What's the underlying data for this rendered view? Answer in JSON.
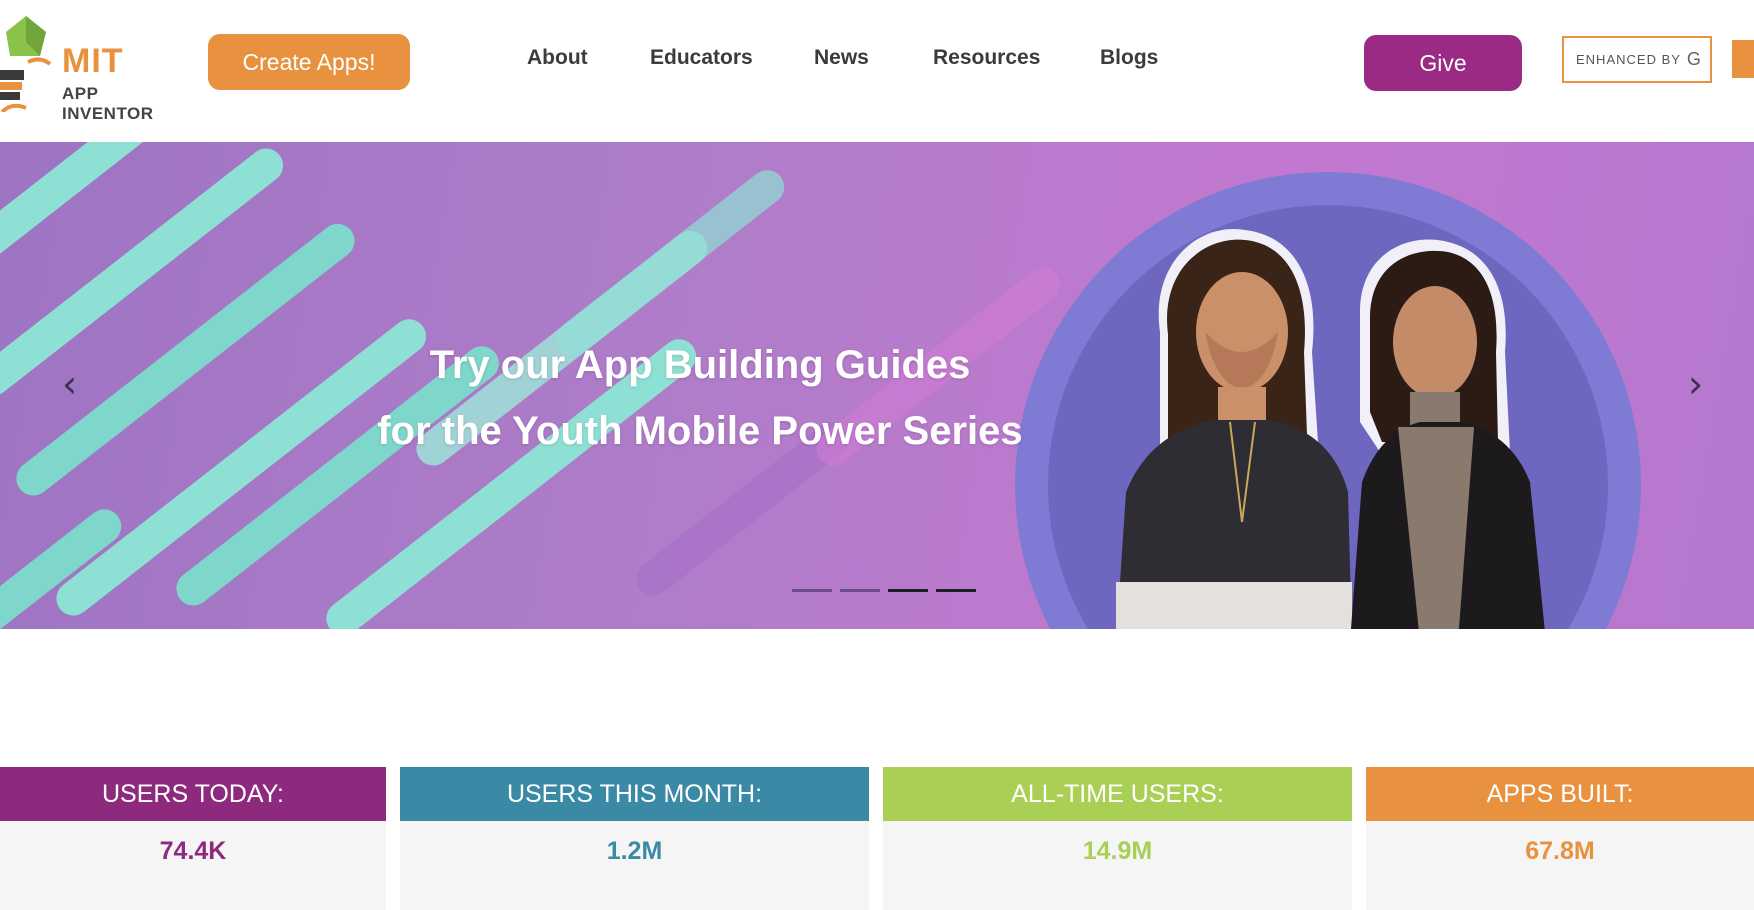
{
  "header": {
    "logo": {
      "line1": "MIT",
      "line2": "APP INVENTOR"
    },
    "create_button": "Create Apps!",
    "nav": [
      {
        "label": "About"
      },
      {
        "label": "Educators"
      },
      {
        "label": "News"
      },
      {
        "label": "Resources"
      },
      {
        "label": "Blogs"
      }
    ],
    "give_button": "Give",
    "search": {
      "enhanced_by": "ENHANCED BY",
      "google_glyph": "G"
    }
  },
  "hero": {
    "title_line1": "Try our App Building Guides",
    "title_line2": "for the Youth Mobile Power Series",
    "prev_glyph": "‹",
    "next_glyph": "›",
    "slides_count": 4,
    "active_slide": 3
  },
  "stats": [
    {
      "label": "USERS TODAY:",
      "value": "74.4K",
      "color": "#8e2a7e"
    },
    {
      "label": "USERS THIS MONTH:",
      "value": "1.2M",
      "color": "#3a8aa6"
    },
    {
      "label": "ALL-TIME USERS:",
      "value": "14.9M",
      "color": "#a9cf54"
    },
    {
      "label": "APPS BUILT:",
      "value": "67.8M",
      "color": "#e8923f"
    }
  ],
  "colors": {
    "orange": "#e8923f",
    "purple": "#9a2a83",
    "teal": "#3a8aa6",
    "green": "#a9cf54"
  }
}
